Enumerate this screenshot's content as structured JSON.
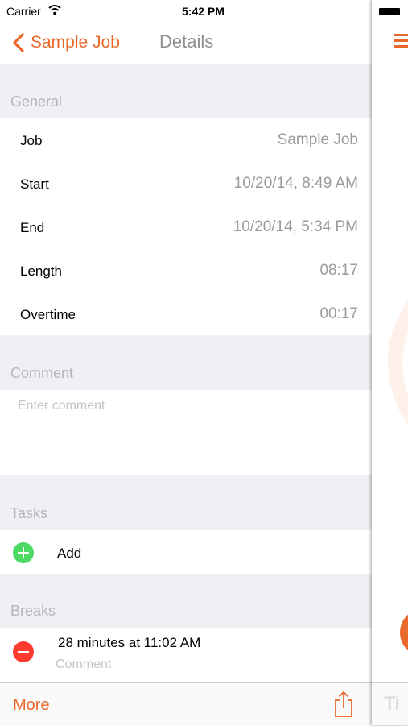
{
  "status_bar": {
    "carrier": "Carrier",
    "time": "5:42 PM"
  },
  "nav": {
    "back_label": "Sample Job",
    "title": "Details"
  },
  "general": {
    "header": "General",
    "rows": [
      {
        "label": "Job",
        "value": "Sample Job"
      },
      {
        "label": "Start",
        "value": "10/20/14, 8:49 AM"
      },
      {
        "label": "End",
        "value": "10/20/14, 5:34 PM"
      },
      {
        "label": "Length",
        "value": "08:17"
      },
      {
        "label": "Overtime",
        "value": "00:17"
      }
    ]
  },
  "comment": {
    "header": "Comment",
    "placeholder": "Enter comment"
  },
  "tasks": {
    "header": "Tasks",
    "add_label": "Add"
  },
  "breaks": {
    "header": "Breaks",
    "items": [
      {
        "text": "28 minutes at 11:02 AM",
        "comment_placeholder": "Comment"
      }
    ]
  },
  "toolbar": {
    "more_label": "More"
  },
  "peek": {
    "bottom_text": "Ti"
  },
  "colors": {
    "accent": "#e8692a",
    "add": "#4cd964",
    "delete": "#ff3b30",
    "background": "#efeff4"
  },
  "icons": {
    "back": "chevron-left-icon",
    "share": "share-icon",
    "menu": "hamburger-icon",
    "add": "plus-circle-icon",
    "remove": "minus-circle-icon",
    "wifi": "wifi-icon",
    "battery": "battery-icon"
  }
}
